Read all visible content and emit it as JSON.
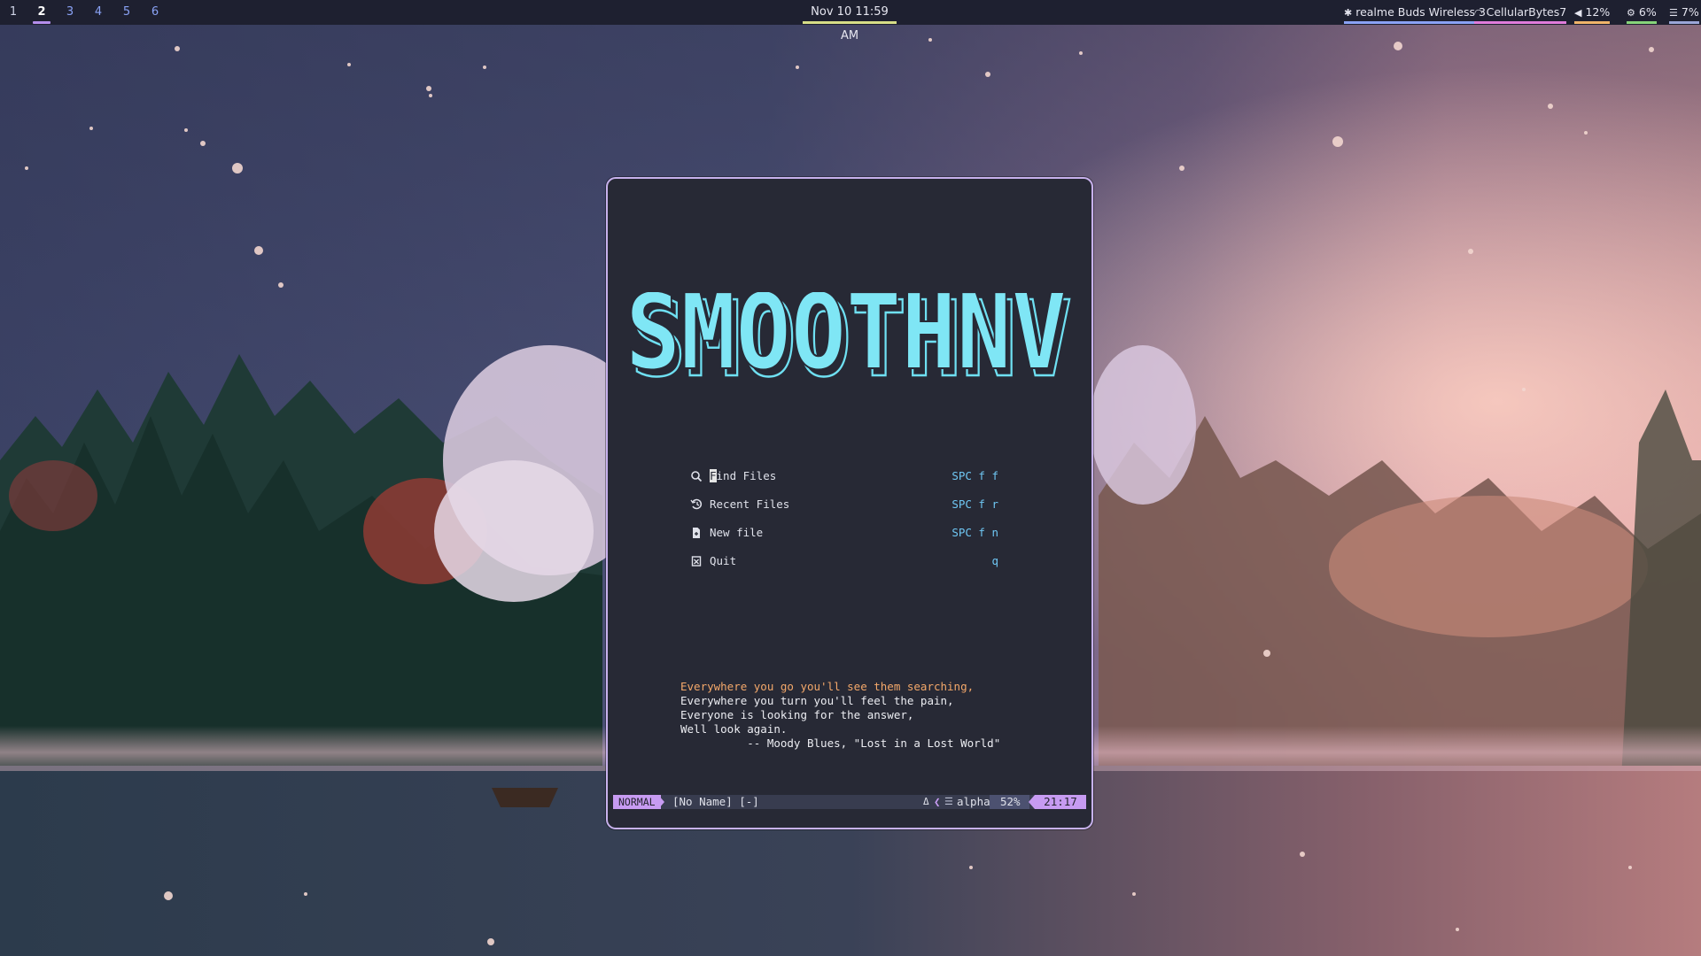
{
  "topbar": {
    "workspaces": [
      "1",
      "2",
      "3",
      "4",
      "5",
      "6"
    ],
    "active_workspace": "2",
    "clock": "Nov 10  11:59 AM",
    "bluetooth": "realme Buds Wireless 3",
    "wifi": "CellularBytes7",
    "volume": "12%",
    "cpu": "6%",
    "memory": "7%",
    "colors": {
      "bluetooth": "#8aa2f5",
      "wifi": "#e07cdb",
      "volume": "#f0b46a",
      "cpu": "#86d47a",
      "memory": "#9aa6d8"
    }
  },
  "editor": {
    "logo_text": "SMOOTHNV",
    "menu": [
      {
        "icon": "search-icon",
        "label": "Find Files",
        "first_char": "F",
        "rest": "ind Files",
        "key": "SPC f f"
      },
      {
        "icon": "history-icon",
        "label": "Recent Files",
        "key": "SPC f r"
      },
      {
        "icon": "file-icon",
        "label": "New file",
        "key": "SPC f n"
      },
      {
        "icon": "quit-icon",
        "label": "Quit",
        "key": "q"
      }
    ],
    "quote_lines": [
      "Everywhere you go you'll see them searching,",
      "Everywhere you turn you'll feel the pain,",
      "Everyone is looking for the answer,",
      "Well look again.",
      "          -- Moody Blues, \"Lost in a Lost World\""
    ],
    "statusline": {
      "mode": "NORMAL",
      "file": "[No Name] [-]",
      "delta": "Δ",
      "filetype": "alpha",
      "percent": "52%",
      "position": "21:17"
    }
  }
}
